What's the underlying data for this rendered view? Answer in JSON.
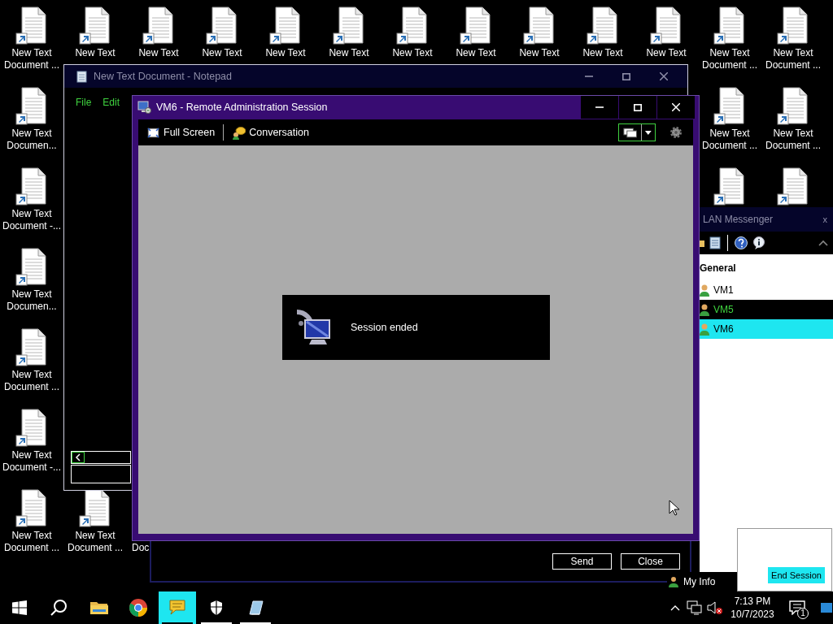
{
  "desktop": {
    "rows": [
      [
        {
          "kind": "shortcut",
          "lines": [
            "New Text",
            "Document ..."
          ]
        },
        {
          "kind": "shortcut",
          "lines": [
            "New Text"
          ]
        },
        {
          "kind": "shortcut",
          "lines": [
            "New Text"
          ]
        },
        {
          "kind": "shortcut",
          "lines": [
            "New Text"
          ]
        },
        {
          "kind": "shortcut",
          "lines": [
            "New Text"
          ]
        },
        {
          "kind": "shortcut",
          "lines": [
            "New Text"
          ]
        },
        {
          "kind": "shortcut",
          "lines": [
            "New Text"
          ]
        },
        {
          "kind": "shortcut",
          "lines": [
            "New Text"
          ]
        },
        {
          "kind": "shortcut",
          "lines": [
            "New Text"
          ]
        },
        {
          "kind": "shortcut",
          "lines": [
            "New Text"
          ]
        },
        {
          "kind": "shortcut",
          "lines": [
            "New Text"
          ]
        },
        {
          "kind": "shortcut",
          "lines": [
            "New Text",
            "Document ..."
          ]
        },
        {
          "kind": "shortcut",
          "lines": [
            "New Text",
            "Document ..."
          ]
        }
      ],
      [
        {
          "kind": "shortcut",
          "lines": [
            "New Text",
            "Documen..."
          ]
        },
        null,
        null,
        null,
        null,
        null,
        null,
        null,
        null,
        null,
        null,
        {
          "kind": "shortcut",
          "lines": [
            "New Text",
            "Document ..."
          ]
        },
        {
          "kind": "shortcut",
          "lines": [
            "New Text",
            "Document ..."
          ]
        }
      ],
      [
        {
          "kind": "shortcut",
          "lines": [
            "New Text",
            "Document -..."
          ]
        },
        null,
        null,
        null,
        null,
        null,
        null,
        null,
        null,
        null,
        null,
        {
          "kind": "shortcut"
        },
        {
          "kind": "shortcut"
        }
      ],
      [
        {
          "kind": "shortcut",
          "lines": [
            "New Text",
            "Documen..."
          ]
        }
      ],
      [
        {
          "kind": "shortcut",
          "lines": [
            "New Text",
            "Document ..."
          ]
        }
      ],
      [
        {
          "kind": "shortcut",
          "lines": [
            "New Text",
            "Document -..."
          ]
        }
      ],
      [
        {
          "kind": "shortcut",
          "lines": [
            "New Text",
            "Document ..."
          ]
        },
        {
          "kind": "shortcut",
          "lines": [
            "New Text",
            "Document ..."
          ]
        },
        {
          "kind": "label_only",
          "lines": [
            "Doc"
          ]
        }
      ]
    ]
  },
  "notepad": {
    "title": "New Text Document - Notepad",
    "menu": [
      "File",
      "Edit"
    ]
  },
  "chat_window": {
    "buttons": [
      "Send",
      "Close"
    ]
  },
  "remote_session": {
    "title": "VM6 - Remote Administration Session",
    "toolbar": [
      {
        "kind": "fullscreen",
        "label": "Full Screen"
      },
      {
        "kind": "conversation",
        "label": "Conversation"
      }
    ],
    "message": "Session ended"
  },
  "lan_messenger": {
    "title": "LAN Messenger",
    "close_glyph": "x",
    "group": "General",
    "contacts": [
      {
        "name": "VM1",
        "selected": false,
        "hovered": false
      },
      {
        "name": "VM5",
        "selected": false,
        "hovered": true
      },
      {
        "name": "VM6",
        "selected": true,
        "hovered": false
      }
    ],
    "my_info": "My Info"
  },
  "popup": {
    "button": "End Session"
  },
  "taskbar": {
    "apps": [
      {
        "kind": "explorer",
        "active": false,
        "running": false
      },
      {
        "kind": "chrome",
        "active": false,
        "running": false
      },
      {
        "kind": "messenger",
        "active": true,
        "running": true
      },
      {
        "kind": "shield",
        "active": false,
        "running": true
      },
      {
        "kind": "notepad",
        "active": false,
        "running": true
      }
    ],
    "time": "7:13 PM",
    "date": "10/7/2023",
    "notifications": "1"
  }
}
